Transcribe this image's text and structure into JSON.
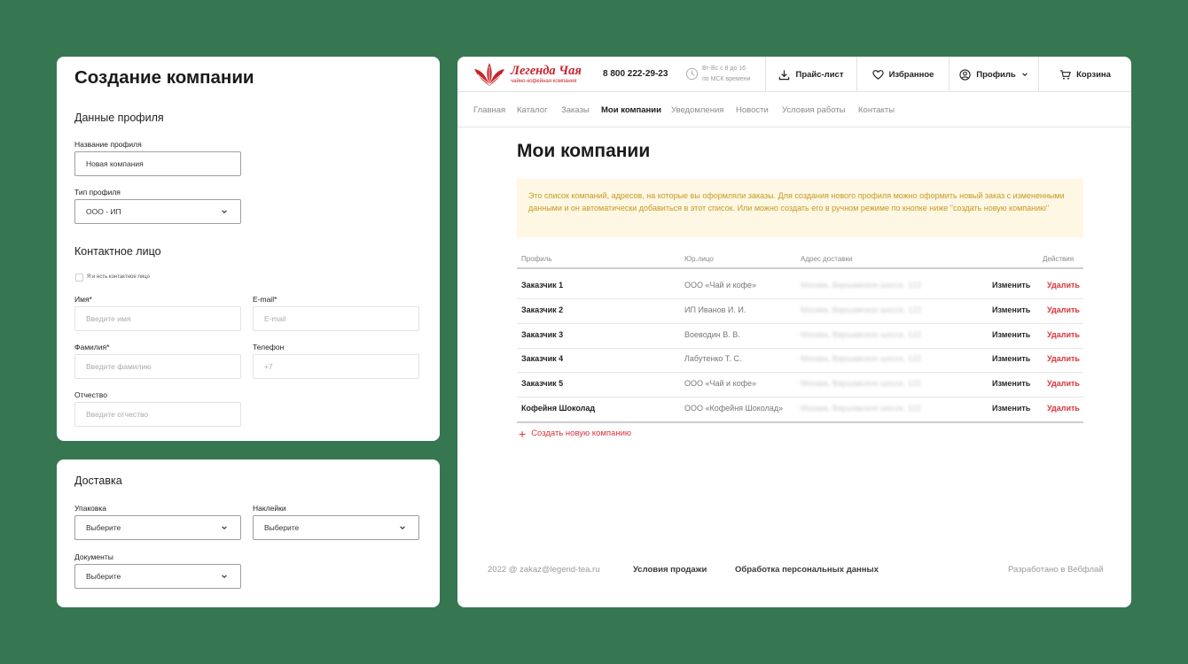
{
  "form": {
    "title": "Создание компании",
    "profile_section": "Данные профиля",
    "profile_name_label": "Название профиля",
    "profile_name_value": "Новая компания",
    "profile_type_label": "Тип профиля",
    "profile_type_value": "ООО - ИП",
    "contact_section": "Контактное лицо",
    "self_contact_label": "Я и есть контактное лицо",
    "first_name_label": "Имя*",
    "first_name_placeholder": "Введите имя",
    "email_label": "E-mail*",
    "email_placeholder": "E-mail",
    "last_name_label": "Фамилия*",
    "last_name_placeholder": "Введите фамилию",
    "phone_label": "Телефон",
    "phone_placeholder": "+7",
    "middle_name_label": "Отчество",
    "middle_name_placeholder": "Введите отчество"
  },
  "delivery": {
    "title": "Доставка",
    "packaging_label": "Упаковка",
    "packaging_value": "Выберите",
    "stickers_label": "Наклейки",
    "stickers_value": "Выберите",
    "documents_label": "Документы",
    "documents_value": "Выберите"
  },
  "header": {
    "logo_name": "Легенда Чая",
    "logo_tagline": "чайно-кофейная компания",
    "phone": "8 800 222-29-23",
    "hours_line1": "Вт-Вс с 8 до 16",
    "hours_line2": "по МСК времени",
    "pricelist": "Прайс-лист",
    "favorites": "Избранное",
    "profile": "Профиль",
    "cart": "Корзина"
  },
  "nav": [
    "Главная",
    "Каталог",
    "Заказы",
    "Мои компании",
    "Уведомления",
    "Новости",
    "Условия работы",
    "Контакты"
  ],
  "nav_active": "Мои компании",
  "page": {
    "title": "Мои компании",
    "notice": "Это список компаний, адресов, на которые вы оформляли заказы. Для создания нового профиля можно оформить новый заказ с измененными данными и он автоматически добавиться в этот список. Или можно создать его в ручном режиме по кнопке ниже \"создать новую компанию\"",
    "columns": [
      "Профиль",
      "Юр.лицо",
      "Адрес доставки",
      "Действия"
    ],
    "rows": [
      {
        "profile": "Заказчик 1",
        "legal": "ООО «Чай и кофе»",
        "address": "Москва, Варшавское шоссе, 122",
        "edit": "Изменить",
        "delete": "Удалить"
      },
      {
        "profile": "Заказчик 2",
        "legal": "ИП Иванов И. И.",
        "address": "Москва, Варшавское шоссе, 122",
        "edit": "Изменить",
        "delete": "Удалить"
      },
      {
        "profile": "Заказчик 3",
        "legal": "Воеводин В. В.",
        "address": "Москва, Варшавское шоссе, 122",
        "edit": "Изменить",
        "delete": "Удалить"
      },
      {
        "profile": "Заказчик 4",
        "legal": "Лабутенко Т. С.",
        "address": "Москва, Варшавское шоссе, 122",
        "edit": "Изменить",
        "delete": "Удалить"
      },
      {
        "profile": "Заказчик 5",
        "legal": "ООО «Чай и кофе»",
        "address": "Москва, Варшавское шоссе, 122",
        "edit": "Изменить",
        "delete": "Удалить"
      },
      {
        "profile": "Кофейня Шоколад",
        "legal": "ООО «Кофейня Шоколад»",
        "address": "Москва, Варшавское шоссе, 122",
        "edit": "Изменить",
        "delete": "Удалить"
      }
    ],
    "create_link": "Создать новую компанию"
  },
  "footer": {
    "copyright": "2022 @ zakaz@legend-tea.ru",
    "terms": "Условия продажи",
    "privacy": "Обработка персональных данных",
    "developer": "Разработано в Вебфлай"
  },
  "colors": {
    "background": "#367751",
    "brand_red": "#c6242b",
    "delete_red": "#d9343b",
    "notice_bg": "#fdf7e3",
    "notice_text": "#c79a24"
  },
  "icons": [
    "chevron-down-icon",
    "clock-icon",
    "download-icon",
    "heart-icon",
    "user-icon",
    "cart-icon",
    "plus-icon",
    "tea-leaf-logo"
  ]
}
